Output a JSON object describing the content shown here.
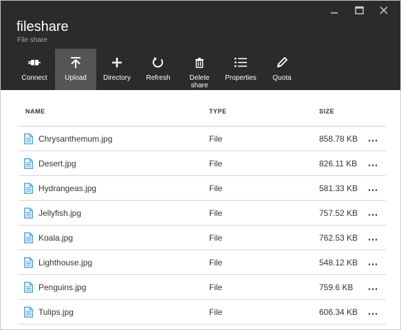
{
  "window": {
    "minimize_icon": "minimize-icon",
    "maximize_icon": "maximize-icon",
    "close_icon": "close-icon"
  },
  "header": {
    "title": "fileshare",
    "subtitle": "File share"
  },
  "toolbar": [
    {
      "label": "Connect",
      "icon": "connect-plug-icon"
    },
    {
      "label": "Upload",
      "icon": "upload-arrow-icon",
      "active": true
    },
    {
      "label": "Directory",
      "icon": "plus-icon"
    },
    {
      "label": "Refresh",
      "icon": "refresh-icon"
    },
    {
      "label": "Delete share",
      "icon": "trash-icon"
    },
    {
      "label": "Properties",
      "icon": "list-icon"
    },
    {
      "label": "Quota",
      "icon": "pencil-icon"
    }
  ],
  "table": {
    "columns": [
      "NAME",
      "TYPE",
      "SIZE"
    ],
    "rows": [
      {
        "name": "Chrysanthemum.jpg",
        "type": "File",
        "size": "858.78 KB"
      },
      {
        "name": "Desert.jpg",
        "type": "File",
        "size": "826.11 KB"
      },
      {
        "name": "Hydrangeas.jpg",
        "type": "File",
        "size": "581.33 KB"
      },
      {
        "name": "Jellyfish.jpg",
        "type": "File",
        "size": "757.52 KB"
      },
      {
        "name": "Koala.jpg",
        "type": "File",
        "size": "762.53 KB"
      },
      {
        "name": "Lighthouse.jpg",
        "type": "File",
        "size": "548.12 KB"
      },
      {
        "name": "Penguins.jpg",
        "type": "File",
        "size": "759.6 KB"
      },
      {
        "name": "Tulips.jpg",
        "type": "File",
        "size": "606.34 KB"
      }
    ]
  },
  "colors": {
    "header_bg": "#2b2b2b",
    "toolbar_active": "#555555",
    "file_icon": "#4a9bd4"
  }
}
